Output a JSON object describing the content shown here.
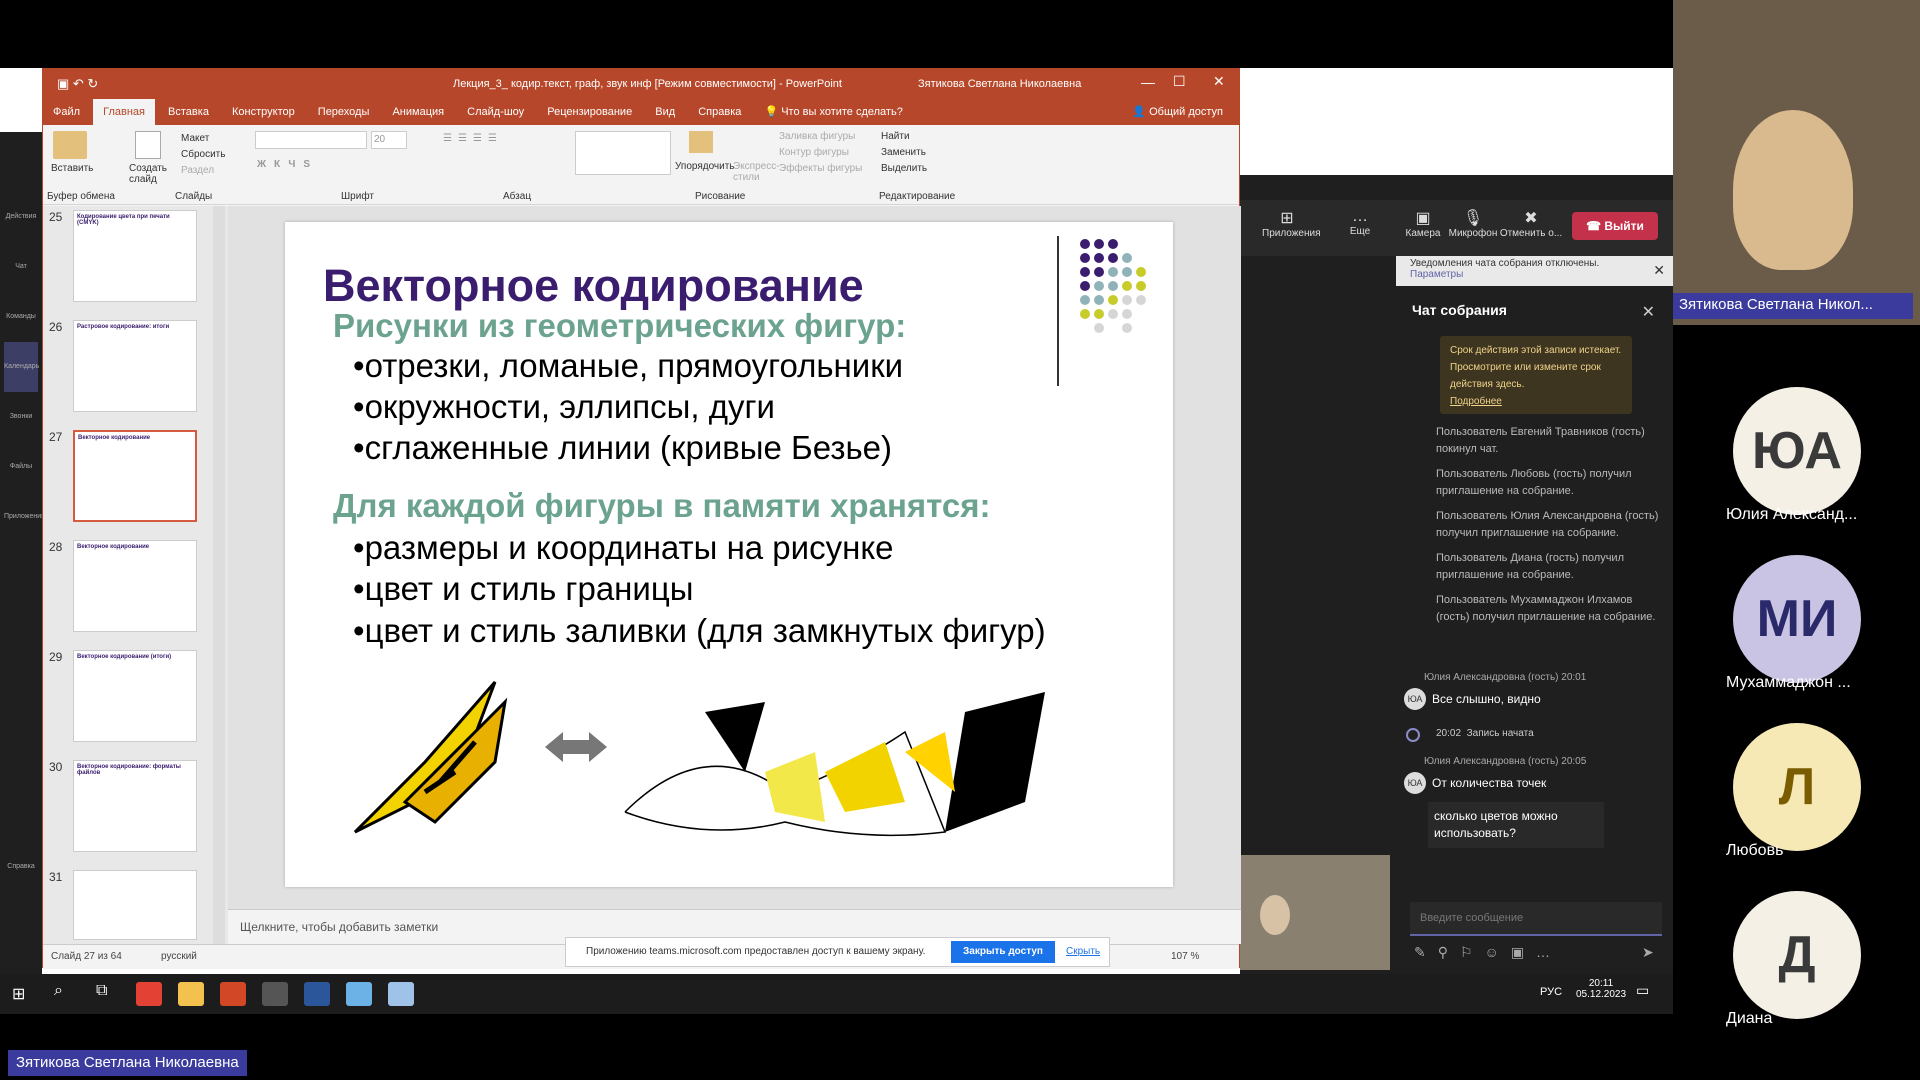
{
  "ppt": {
    "window_title": "Лекция_3_ кодир.текст, граф, звук инф [Режим совместимости]  -  PowerPoint",
    "user": "Зятикова Светлана Николаевна",
    "tabs": [
      "Файл",
      "Главная",
      "Вставка",
      "Конструктор",
      "Переходы",
      "Анимация",
      "Слайд-шоу",
      "Рецензирование",
      "Вид",
      "Справка"
    ],
    "active_tab": "Главная",
    "tell_me": "Что вы хотите сделать?",
    "share": "Общий доступ",
    "ribbon": {
      "paste": "Вставить",
      "clipboard_group": "Буфер обмена",
      "new_slide": "Создать слайд",
      "layout": "Макет",
      "reset": "Сбросить",
      "section": "Раздел",
      "slides_group": "Слайды",
      "font_size": "20",
      "font_group": "Шрифт",
      "paragraph_group": "Абзац",
      "arrange": "Упорядочить",
      "quick_styles": "Экспресс-стили",
      "shape_fill": "Заливка фигуры",
      "shape_outline": "Контур фигуры",
      "shape_effects": "Эффекты фигуры",
      "drawing_group": "Рисование",
      "find": "Найти",
      "replace": "Заменить",
      "select": "Выделить",
      "editing_group": "Редактирование"
    },
    "thumbnails": [
      {
        "num": "25",
        "title": "Кодирование цвета при печати (CMYK)"
      },
      {
        "num": "26",
        "title": "Растровое кодирование: итоги"
      },
      {
        "num": "27",
        "title": "Векторное кодирование"
      },
      {
        "num": "28",
        "title": "Векторное кодирование"
      },
      {
        "num": "29",
        "title": "Векторное кодирование (итоги)"
      },
      {
        "num": "30",
        "title": "Векторное кодирование: форматы файлов"
      },
      {
        "num": "31",
        "title": ""
      }
    ],
    "slide": {
      "title": "Векторное кодирование",
      "sub1": "Рисунки из геометрических фигур:",
      "bullets1": [
        "отрезки, ломаные, прямоугольники",
        "окружности, эллипсы, дуги",
        "сглаженные линии (кривые Безье)"
      ],
      "sub2": "Для каждой фигуры в памяти хранятся:",
      "bullets2": [
        "размеры и координаты на рисунке",
        "цвет и стиль границы",
        "цвет и стиль заливки (для замкнутых фигур)"
      ]
    },
    "notes_placeholder": "Щелкните, чтобы добавить заметки",
    "status": {
      "slide": "Слайд 27 из 64",
      "lang": "русский",
      "zoom": "107 %"
    }
  },
  "share_bar": {
    "text": "Приложению teams.microsoft.com предоставлен доступ к вашему экрану.",
    "stop": "Закрыть доступ",
    "hide": "Скрыть"
  },
  "teams": {
    "rail": [
      "Действия",
      "Чат",
      "Команды",
      "Календарь",
      "Звонки",
      "Файлы",
      "Приложения",
      "Справка"
    ],
    "controls": [
      "Приложения",
      "Еще",
      "Камера",
      "Микрофон",
      "Отменить о..."
    ],
    "leave": "Выйти",
    "notice": "Уведомления чата собрания отключены.",
    "notice_link": "Параметры",
    "chat_title": "Чат собрания",
    "warning": "Срок действия этой записи истекает. Просмотрите или измените срок действия здесь.",
    "warning_link": "Подробнее",
    "events": [
      "Пользователь Евгений Травников (гость) покинул чат.",
      "Пользователь Любовь (гость) получил приглашение на собрание.",
      "Пользователь Юлия Александровна (гость) получил приглашение на собрание.",
      "Пользователь Диана (гость) получил приглашение на собрание.",
      "Пользователь Мухаммаджон Илхамов (гость) получил приглашение на собрание."
    ],
    "msg1_author": "Юлия Александровна (гость)  20:01",
    "msg1": "Все слышно, видно",
    "rec_time": "20:02",
    "rec": "Запись начата",
    "msg2_author": "Юлия Александровна (гость)  20:05",
    "msg2a": "От количества точек",
    "msg2b": "сколько цветов можно использовать?",
    "input_placeholder": "Введите сообщение"
  },
  "participants": {
    "main_name": "Зятикова Светлана Никол...",
    "list": [
      {
        "initials": "ЮА",
        "name": "Юлия Александ..."
      },
      {
        "initials": "МИ",
        "name": "Мухаммаджон ..."
      },
      {
        "initials": "Л",
        "name": "Любовь"
      },
      {
        "initials": "Д",
        "name": "Диана"
      }
    ]
  },
  "taskbar": {
    "lang": "РУС",
    "time": "20:11",
    "date": "05.12.2023"
  },
  "presenter_label": "Зятикова Светлана Николаевна",
  "colors": {
    "ppt_accent": "#b7472a",
    "title": "#3a1d6e",
    "subtitle": "#6ba38f",
    "leave": "#c4314b"
  }
}
